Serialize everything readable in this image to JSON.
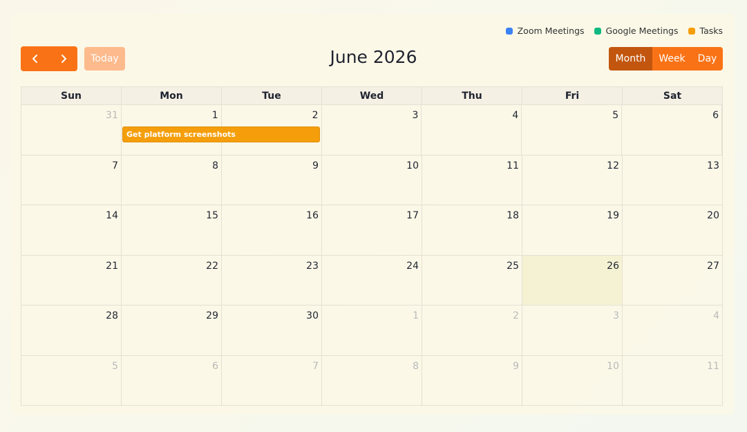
{
  "legend": [
    {
      "label": "Zoom Meetings",
      "color": "#3b82f6"
    },
    {
      "label": "Google Meetings",
      "color": "#10b981"
    },
    {
      "label": "Tasks",
      "color": "#f59e0b"
    }
  ],
  "toolbar": {
    "prev_icon": "chevron-left-icon",
    "next_icon": "chevron-right-icon",
    "today_label": "Today",
    "title": "June 2026",
    "views": [
      "Month",
      "Week",
      "Day"
    ],
    "active_view": "Month",
    "accent_color": "#f97316"
  },
  "weekdays": [
    "Sun",
    "Mon",
    "Tue",
    "Wed",
    "Thu",
    "Fri",
    "Sat"
  ],
  "weeks": [
    [
      "31",
      "1",
      "2",
      "3",
      "4",
      "5",
      "6"
    ],
    [
      "7",
      "8",
      "9",
      "10",
      "11",
      "12",
      "13"
    ],
    [
      "14",
      "15",
      "16",
      "17",
      "18",
      "19",
      "20"
    ],
    [
      "21",
      "22",
      "23",
      "24",
      "25",
      "26",
      "27"
    ],
    [
      "28",
      "29",
      "30",
      "1",
      "2",
      "3",
      "4"
    ],
    [
      "5",
      "6",
      "7",
      "8",
      "9",
      "10",
      "11"
    ]
  ],
  "other_month": [
    [
      true,
      false,
      false,
      false,
      false,
      false,
      false
    ],
    [
      false,
      false,
      false,
      false,
      false,
      false,
      false
    ],
    [
      false,
      false,
      false,
      false,
      false,
      false,
      false
    ],
    [
      false,
      false,
      false,
      false,
      false,
      false,
      false
    ],
    [
      false,
      false,
      false,
      true,
      true,
      true,
      true
    ],
    [
      true,
      true,
      true,
      true,
      true,
      true,
      true
    ]
  ],
  "today": "26",
  "events": [
    {
      "title": "Get platform screenshots",
      "category": "Tasks",
      "start": "2",
      "end": "3"
    }
  ]
}
